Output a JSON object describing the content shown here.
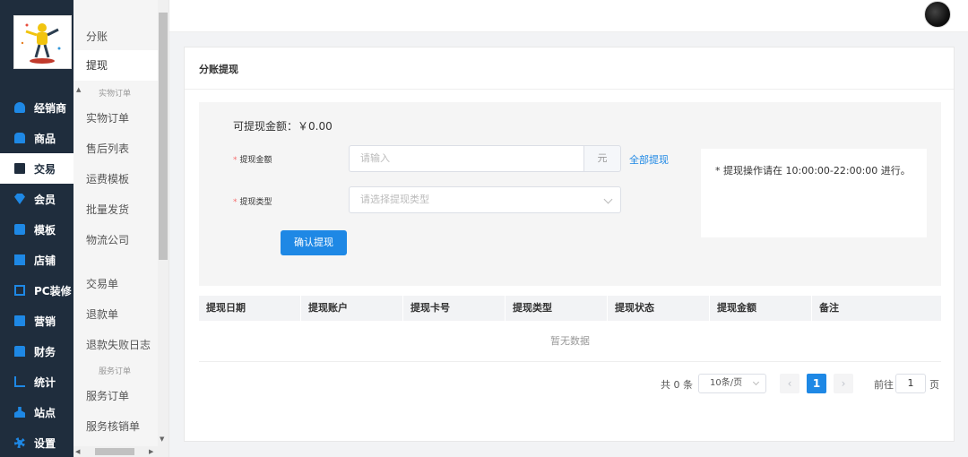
{
  "nav": {
    "items": [
      {
        "label": "经销商",
        "icon": "users-icon"
      },
      {
        "label": "商品",
        "icon": "bag-icon"
      },
      {
        "label": "交易",
        "icon": "clipboard-icon"
      },
      {
        "label": "会员",
        "icon": "diamond-icon"
      },
      {
        "label": "模板",
        "icon": "template-icon"
      },
      {
        "label": "店铺",
        "icon": "store-icon"
      },
      {
        "label": "PC装修",
        "icon": "monitor-icon"
      },
      {
        "label": "营销",
        "icon": "gift-icon"
      },
      {
        "label": "财务",
        "icon": "finance-icon"
      },
      {
        "label": "统计",
        "icon": "chart-icon"
      },
      {
        "label": "站点",
        "icon": "sitemap-icon"
      },
      {
        "label": "设置",
        "icon": "gear-icon"
      }
    ],
    "active_index": 2
  },
  "submenu": {
    "items": {
      "fenzhang": "分账",
      "tixian": "提现",
      "shiwu_order": "实物订单",
      "shouhou": "售后列表",
      "yunfei": "运费模板",
      "piliang": "批量发货",
      "wuliu": "物流公司",
      "jiaoyidan": "交易单",
      "tuikuan": "退款单",
      "tuikuan_fail": "退款失败日志",
      "fuwu_order": "服务订单",
      "fuwu_hexiao": "服务核销单"
    },
    "groups": {
      "shiwu": "实物订单",
      "fuwu": "服务订单"
    }
  },
  "card": {
    "title": "分账提现",
    "balance": "可提现金额：￥0.00",
    "amount_label": "提现金额",
    "amount_placeholder": "请输入",
    "amount_unit": "元",
    "all_link": "全部提现",
    "type_label": "提现类型",
    "type_placeholder": "请选择提现类型",
    "confirm": "确认提现",
    "notice": "* 提现操作请在 10:00:00-22:00:00 进行。"
  },
  "table": {
    "columns": [
      "提现日期",
      "提现账户",
      "提现卡号",
      "提现类型",
      "提现状态",
      "提现金额",
      "备注"
    ],
    "empty": "暂无数据"
  },
  "pager": {
    "total": "共 0 条",
    "size": "10条/页",
    "prev": "‹",
    "current": "1",
    "next": "›",
    "goto_prefix": "前往",
    "goto_value": "1",
    "goto_suffix": "页"
  },
  "colors": {
    "sidebar_bg": "#1f2d3d",
    "accent": "#1e88e5",
    "required": "#f56c6c"
  }
}
